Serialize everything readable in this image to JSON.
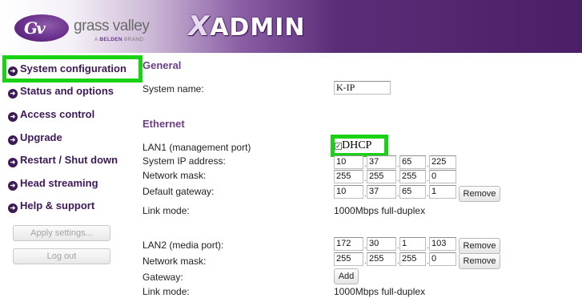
{
  "brand": {
    "logo_mark": "Gv",
    "name": "grass valley",
    "sub_prefix": "A",
    "sub_bold": "BELDEN",
    "sub_suffix": "BRAND",
    "product": "ADMIN",
    "product_mark": "X"
  },
  "sidebar": {
    "items": [
      {
        "label": "System configuration",
        "selected": true
      },
      {
        "label": "Status and options"
      },
      {
        "label": "Access control"
      },
      {
        "label": "Upgrade"
      },
      {
        "label": "Restart / Shut down"
      },
      {
        "label": "Head streaming"
      },
      {
        "label": "Help & support"
      }
    ],
    "apply_label": "Apply settings...",
    "logout_label": "Log out"
  },
  "general": {
    "title": "General",
    "system_name_label": "System name:",
    "system_name_value": "K-IP"
  },
  "ethernet": {
    "title": "Ethernet",
    "lan1": {
      "label": "LAN1 (management port)",
      "dhcp_label": "DHCP",
      "dhcp_checked": true,
      "ip_label": "System IP address:",
      "ip": [
        "10",
        "37",
        "65",
        "225"
      ],
      "mask_label": "Network mask:",
      "mask": [
        "255",
        "255",
        "255",
        "0"
      ],
      "gateway_label": "Default gateway:",
      "gateway": [
        "10",
        "37",
        "65",
        "1"
      ],
      "remove_label": "Remove",
      "link_label": "Link mode:",
      "link_value": "1000Mbps full-duplex"
    },
    "lan2": {
      "label": "LAN2 (media port):",
      "ip": [
        "172",
        "30",
        "1",
        "103"
      ],
      "remove1_label": "Remove",
      "mask_label": "Network mask:",
      "mask": [
        "255",
        "255",
        "255",
        "0"
      ],
      "remove2_label": "Remove",
      "gateway_label": "Gateway:",
      "add_label": "Add",
      "link_label": "Link mode:",
      "link_value": "1000Mbps full-duplex"
    }
  },
  "colors": {
    "highlight": "#19d213",
    "nav_text": "#3d1a56",
    "section_title": "#6a3f84",
    "header_dark": "#4a1f66"
  }
}
